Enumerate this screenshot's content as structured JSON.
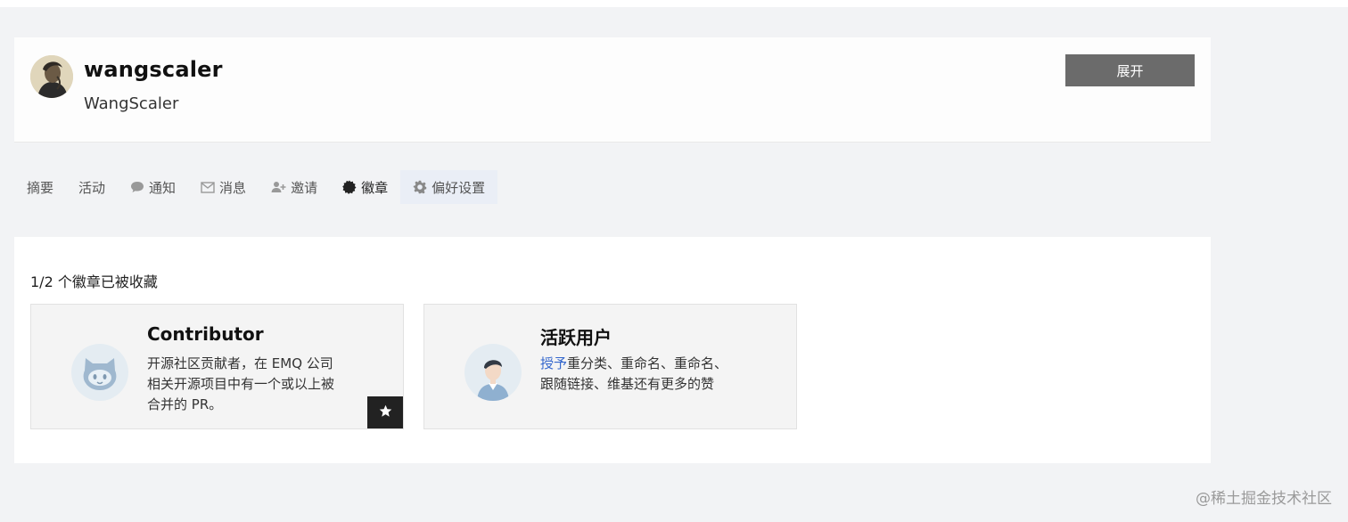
{
  "profile": {
    "username": "wangscaler",
    "display_name": "WangScaler",
    "expand_label": "展开"
  },
  "tabs": [
    {
      "label": "摘要",
      "icon": ""
    },
    {
      "label": "活动",
      "icon": ""
    },
    {
      "label": "通知",
      "icon": "comment-icon"
    },
    {
      "label": "消息",
      "icon": "envelope-icon"
    },
    {
      "label": "邀请",
      "icon": "user-plus-icon"
    },
    {
      "label": "徽章",
      "icon": "certificate-icon",
      "active": true
    },
    {
      "label": "偏好设置",
      "icon": "gear-icon"
    }
  ],
  "badges": {
    "count_text": "1/2 个徽章已被收藏",
    "items": [
      {
        "title": "Contributor",
        "description": "开源社区贡献者，在 EMQ 公司相关开源项目中有一个或以上被合并的 PR。",
        "icon": "github-octocat-icon",
        "favorited": true
      },
      {
        "title": "活跃用户",
        "description_link": "授予",
        "description_rest": "重分类、重命名、重命名、跟随链接、维基还有更多的赞",
        "icon": "user-person-icon",
        "favorited": false
      }
    ]
  },
  "watermark": "@稀土掘金技术社区",
  "colors": {
    "page_bg": "#f2f3f5",
    "button_bg": "#6b6b6b",
    "link": "#3366cc",
    "fav_bg": "#222222"
  }
}
